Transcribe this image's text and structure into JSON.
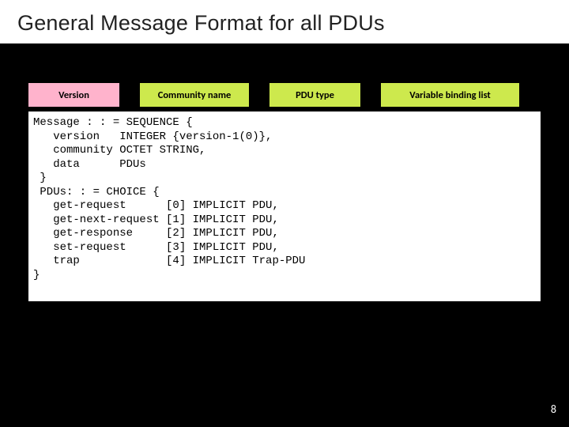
{
  "title": "General Message Format for all PDUs",
  "fields": {
    "version": "Version",
    "community": "Community name",
    "pdutype": "PDU type",
    "varbind": "Variable binding list"
  },
  "code": "Message : : = SEQUENCE {\n   version   INTEGER {version-1(0)},\n   community OCTET STRING,\n   data      PDUs\n }\n PDUs: : = CHOICE {\n   get-request      [0] IMPLICIT PDU,\n   get-next-request [1] IMPLICIT PDU,\n   get-response     [2] IMPLICIT PDU,\n   set-request      [3] IMPLICIT PDU,\n   trap             [4] IMPLICIT Trap-PDU\n}",
  "page_number": "8"
}
